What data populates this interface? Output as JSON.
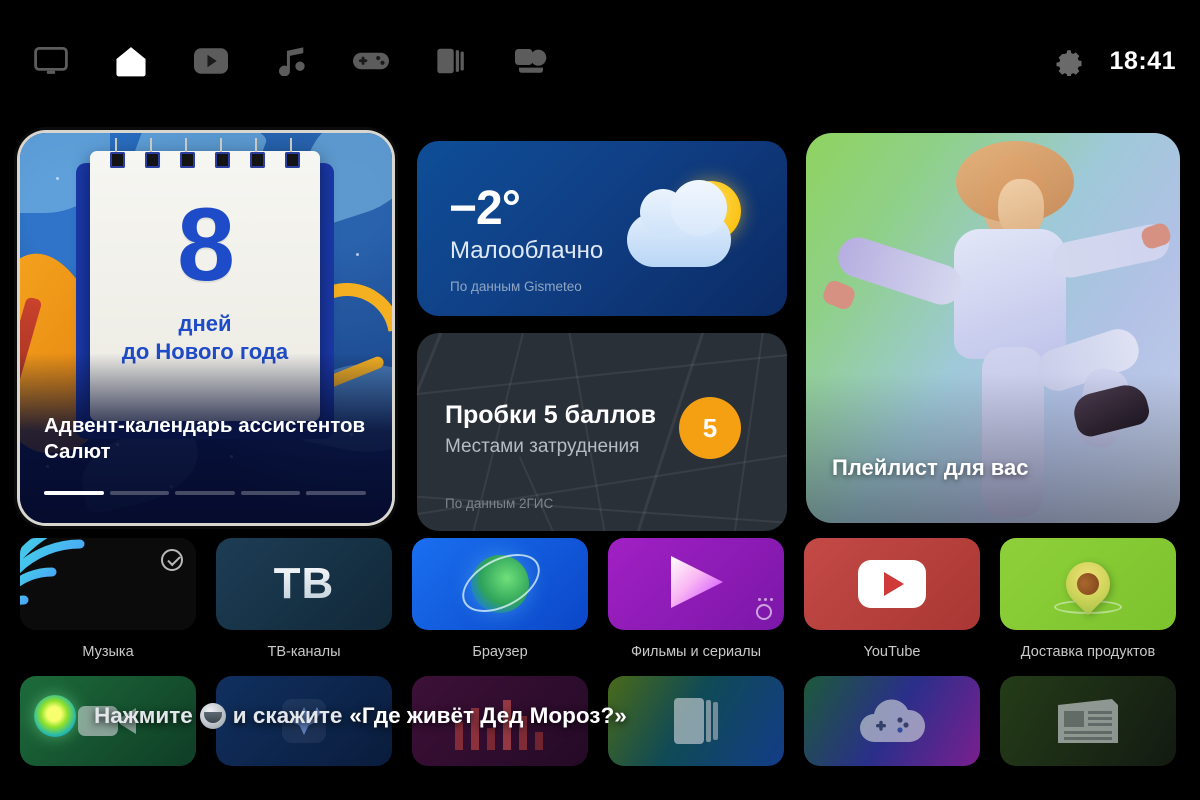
{
  "topbar": {
    "nav_items": [
      {
        "name": "tv-input",
        "icon": "tv-icon",
        "active": false
      },
      {
        "name": "home",
        "icon": "home-icon",
        "active": true
      },
      {
        "name": "video",
        "icon": "video-play-icon",
        "active": false
      },
      {
        "name": "music",
        "icon": "music-note-icon",
        "active": false
      },
      {
        "name": "games",
        "icon": "gamepad-icon",
        "active": false
      },
      {
        "name": "library",
        "icon": "books-icon",
        "active": false
      },
      {
        "name": "apps",
        "icon": "apps-icon",
        "active": false
      }
    ],
    "settings_icon": "gear-icon",
    "clock": "18:41"
  },
  "widgets": {
    "advent": {
      "day_number": "8",
      "line1": "дней",
      "line2": "до Нового года",
      "title": "Адвент-календарь ассистентов Салют",
      "progress_segments": 5,
      "progress_active": 1,
      "focused": true
    },
    "weather": {
      "temperature": "−2°",
      "condition": "Малооблачно",
      "source": "По данным Gismeteo",
      "icon": "sun-behind-cloud-icon"
    },
    "traffic": {
      "title": "Пробки 5 баллов",
      "subtitle": "Местами затруднения",
      "source": "По данным 2ГИС",
      "score": "5",
      "badge_color": "#F5A013"
    },
    "playlist": {
      "title": "Плейлист для вас"
    }
  },
  "apps": [
    {
      "label": "Музыка",
      "icon": "sber-zvuk-waves-icon",
      "badge": "check-circle-icon"
    },
    {
      "label": "ТВ-каналы",
      "icon": "tv-text-icon",
      "logo_text": "ТВ"
    },
    {
      "label": "Браузер",
      "icon": "globe-orbit-icon"
    },
    {
      "label": "Фильмы и сериалы",
      "icon": "play-triangle-icon"
    },
    {
      "label": "YouTube",
      "icon": "youtube-icon"
    },
    {
      "label": "Доставка продуктов",
      "icon": "avocado-pin-icon"
    }
  ],
  "bottom_apps": [
    {
      "icon": "video-call-icon"
    },
    {
      "icon": "sparkle-icon"
    },
    {
      "icon": "equalizer-icon"
    },
    {
      "icon": "books-stack-icon"
    },
    {
      "icon": "cloud-gaming-icon"
    },
    {
      "icon": "news-icon"
    }
  ],
  "assistant": {
    "prefix": "Нажмите",
    "mic_icon": "salute-mic-icon",
    "middle": "и скажите",
    "phrase": "«Где живёт Дед Мороз?»",
    "orb_icon": "salute-orb-icon"
  }
}
